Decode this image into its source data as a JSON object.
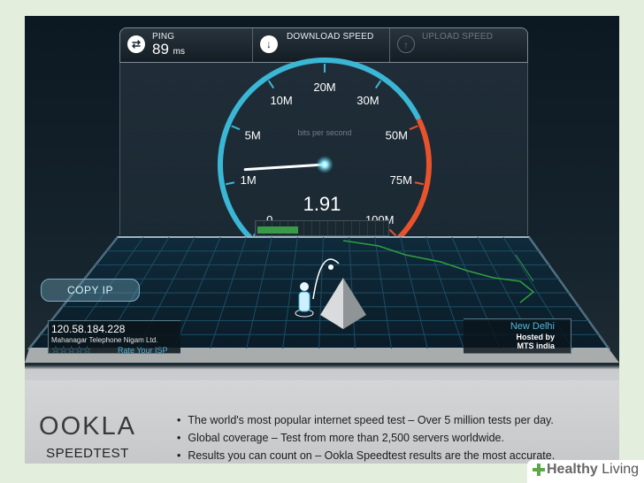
{
  "ping": {
    "label": "PING",
    "value": "89",
    "unit": "ms"
  },
  "download": {
    "label": "DOWNLOAD SPEED"
  },
  "upload": {
    "label": "UPLOAD SPEED"
  },
  "gauge": {
    "ticks": [
      "0",
      "1M",
      "5M",
      "10M",
      "20M",
      "30M",
      "50M",
      "75M",
      "100M"
    ],
    "unit_label": "bits per second",
    "reading": "1.91",
    "reading_value": 1.91,
    "accent_color": "#3bb7d6",
    "danger_color": "#e8532b"
  },
  "copy_ip": {
    "label": "COPY IP"
  },
  "client": {
    "ip": "120.58.184.228",
    "isp": "Mahanagar Telephone Nigam Ltd.",
    "stars": "☆☆☆☆☆",
    "rate_label": "Rate Your ISP"
  },
  "server": {
    "city": "New Delhi",
    "hosted_by": "Hosted by",
    "host": "MTS india"
  },
  "brand": {
    "logo": "OOKLA",
    "product": "SPEEDTEST",
    "bullets": [
      "The world's most popular internet speed test – Over 5 million tests per day.",
      "Global coverage – Test from more than 2,500 servers worldwide.",
      "Results you can count on – Ookla Speedtest results are the most accurate."
    ]
  },
  "watermark": {
    "word1": "Healthy",
    "word2": " Living"
  },
  "icons": {
    "ping": "ping-icon",
    "download": "download-arrow-icon",
    "upload": "upload-arrow-icon",
    "user": "user-icon",
    "server": "server-pyramid-icon"
  }
}
